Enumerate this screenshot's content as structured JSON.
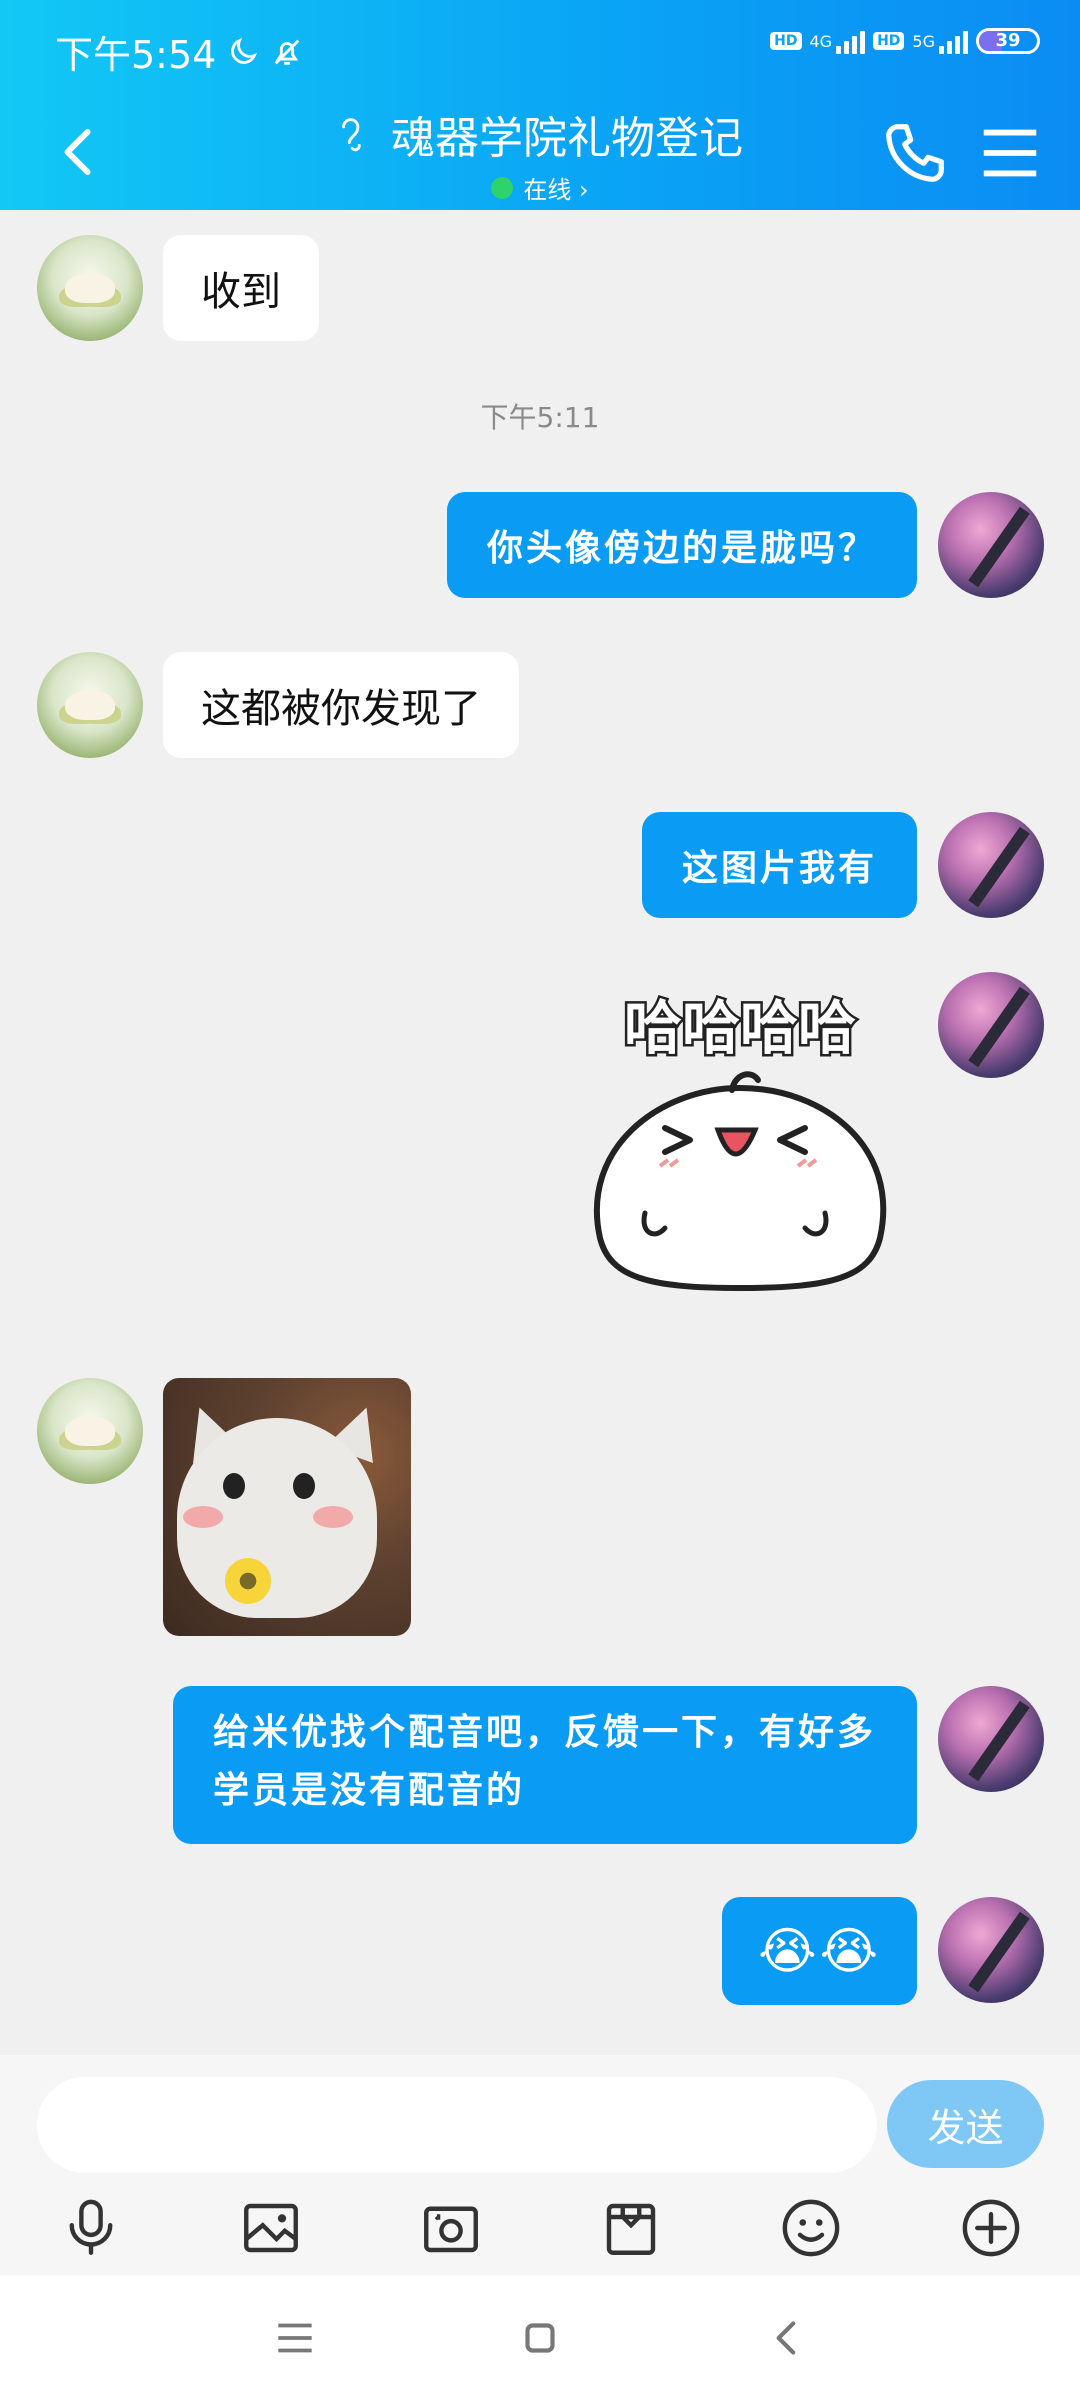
{
  "status": {
    "time": "下午5:54",
    "net1": "4G",
    "net2": "5G",
    "hd": "HD",
    "battery": "39",
    "battery_level": 0.39
  },
  "header": {
    "title": "魂器学院礼物登记",
    "subtitle": "在线 ›"
  },
  "messages": [
    {
      "side": "left",
      "type": "text",
      "text": "收到"
    },
    {
      "side": "center",
      "type": "timestamp",
      "text": "下午5:11"
    },
    {
      "side": "right",
      "type": "text",
      "text": "你头像傍边的是胧吗？"
    },
    {
      "side": "left",
      "type": "text",
      "text": "这都被你发现了"
    },
    {
      "side": "right",
      "type": "text",
      "text": "这图片我有"
    },
    {
      "side": "right",
      "type": "sticker",
      "text": "哈哈哈哈"
    },
    {
      "side": "left",
      "type": "sticker",
      "text": ""
    },
    {
      "side": "right",
      "type": "text",
      "text": "给米优找个配音吧，反馈一下，有好多学员是没有配音的"
    },
    {
      "side": "right",
      "type": "emoji",
      "text": "😭😭"
    }
  ],
  "input": {
    "placeholder": "",
    "send_label": "发送"
  },
  "colors": {
    "header_start": "#12c8f5",
    "header_end": "#0b8cf3",
    "bubble_right": "#0a9cf5",
    "bubble_left": "#ffffff",
    "send_button": "#7fc8f6",
    "online": "#2fd36b"
  },
  "icons": [
    "moon-icon",
    "bell-off-icon",
    "back-icon",
    "ear-icon",
    "phone-icon",
    "menu-icon",
    "mic-icon",
    "image-icon",
    "camera-icon",
    "gift-icon",
    "emoji-icon",
    "plus-icon"
  ]
}
